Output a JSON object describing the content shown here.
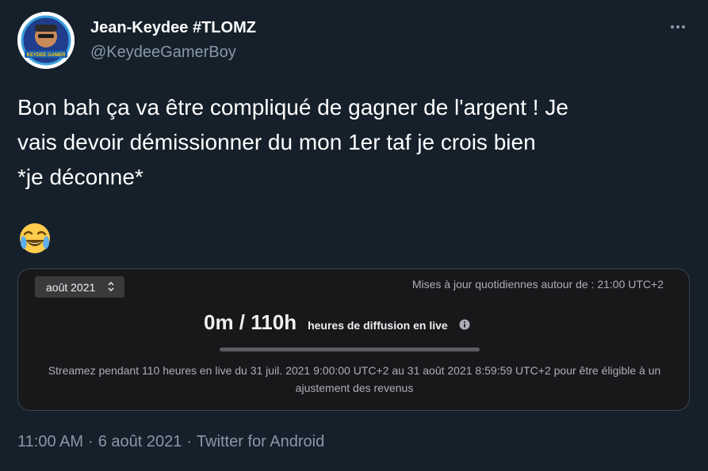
{
  "user": {
    "display_name": "Jean-Keydee #TLOMZ",
    "handle": "@KeydeeGamerBoy",
    "avatar_banner_text": "KEYDEE GAMER"
  },
  "tweet": {
    "text_lines": [
      "Bon bah ça va être compliqué de gagner de l'argent ! Je",
      "vais devoir démissionner du mon 1er taf je crois bien",
      "*je déconne*"
    ],
    "emoji": "face-with-tears-of-joy"
  },
  "card": {
    "month_selector": "août 2021",
    "updates_text": "Mises à jour quotidiennes autour de : 21:00 UTC+2",
    "hours_value": "0m / 110h",
    "hours_label": "heures de diffusion en live",
    "progress_fraction": 0.0,
    "description": "Streamez pendant 110 heures en live du 31 juil. 2021 9:00:00 UTC+2 au 31 août 2021 8:59:59 UTC+2 pour être éligible à un ajustement des revenus"
  },
  "footer": {
    "time": "11:00 AM",
    "separator": "·",
    "date": "6 août 2021",
    "source": "Twitter for Android"
  },
  "colors": {
    "background": "#15202b",
    "card_background": "#18181b",
    "muted_text": "#8899a6",
    "progress_accent": "#bf94ff"
  }
}
